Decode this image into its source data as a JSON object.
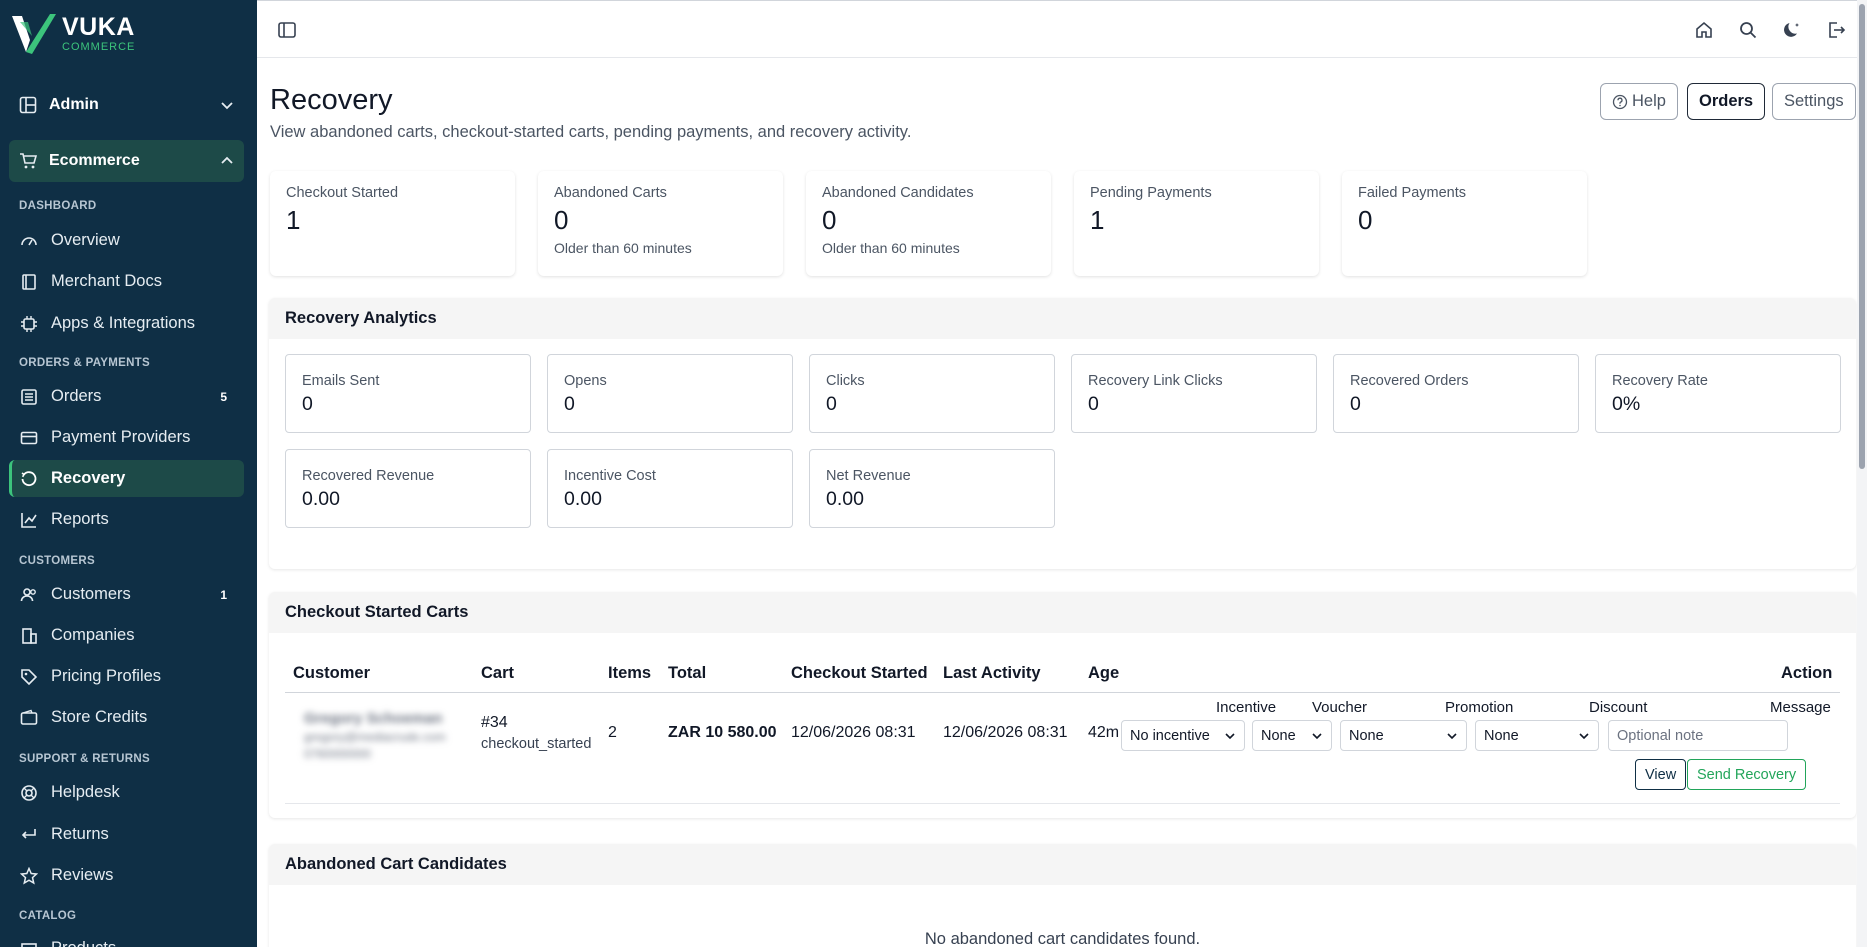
{
  "brand": {
    "name": "VUKA",
    "sub": "COMMERCE"
  },
  "sidebar": {
    "admin_group": "Admin",
    "ecommerce_group": "Ecommerce",
    "sections": {
      "dashboard": "DASHBOARD",
      "orders_payments": "ORDERS & PAYMENTS",
      "customers": "CUSTOMERS",
      "support_returns": "SUPPORT & RETURNS",
      "catalog": "CATALOG"
    },
    "items": {
      "overview": "Overview",
      "merchant_docs": "Merchant Docs",
      "apps": "Apps & Integrations",
      "orders": "Orders",
      "orders_badge": "5",
      "payment_providers": "Payment Providers",
      "recovery": "Recovery",
      "reports": "Reports",
      "customers": "Customers",
      "customers_badge": "1",
      "companies": "Companies",
      "pricing_profiles": "Pricing Profiles",
      "store_credits": "Store Credits",
      "helpdesk": "Helpdesk",
      "returns": "Returns",
      "reviews": "Reviews",
      "products": "Products"
    }
  },
  "header": {
    "title": "Recovery",
    "description": "View abandoned carts, checkout-started carts, pending payments, and recovery activity.",
    "help_label": "Help",
    "orders_label": "Orders",
    "settings_label": "Settings"
  },
  "stats": [
    {
      "label": "Checkout Started",
      "value": "1",
      "sub": ""
    },
    {
      "label": "Abandoned Carts",
      "value": "0",
      "sub": "Older than 60 minutes"
    },
    {
      "label": "Abandoned Candidates",
      "value": "0",
      "sub": "Older than 60 minutes"
    },
    {
      "label": "Pending Payments",
      "value": "1",
      "sub": ""
    },
    {
      "label": "Failed Payments",
      "value": "0",
      "sub": ""
    }
  ],
  "analytics": {
    "title": "Recovery Analytics",
    "metrics": [
      {
        "label": "Emails Sent",
        "value": "0"
      },
      {
        "label": "Opens",
        "value": "0"
      },
      {
        "label": "Clicks",
        "value": "0"
      },
      {
        "label": "Recovery Link Clicks",
        "value": "0"
      },
      {
        "label": "Recovered Orders",
        "value": "0"
      },
      {
        "label": "Recovery Rate",
        "value": "0%"
      },
      {
        "label": "Recovered Revenue",
        "value": "0.00"
      },
      {
        "label": "Incentive Cost",
        "value": "0.00"
      },
      {
        "label": "Net Revenue",
        "value": "0.00"
      }
    ]
  },
  "checkout_carts": {
    "title": "Checkout Started Carts",
    "columns": {
      "customer": "Customer",
      "cart": "Cart",
      "items": "Items",
      "total": "Total",
      "checkout_started": "Checkout Started",
      "last_activity": "Last Activity",
      "age": "Age",
      "action": "Action"
    },
    "row": {
      "customer_name": "Gregory Schoeman",
      "customer_email": "gregory@mediacrude.com",
      "customer_phone": "0760000000",
      "cart_id": "#34",
      "cart_status": "checkout_started",
      "items": "2",
      "total": "ZAR 10 580.00",
      "checkout_started": "12/06/2026 08:31",
      "last_activity": "12/06/2026 08:31",
      "age": "42m"
    },
    "controls": {
      "incentive_label": "Incentive",
      "incentive_value": "No incentive",
      "voucher_label": "Voucher",
      "voucher_value": "None",
      "promotion_label": "Promotion",
      "promotion_value": "None",
      "discount_label": "Discount",
      "discount_value": "None",
      "message_label": "Message",
      "message_placeholder": "Optional note",
      "view_label": "View",
      "send_label": "Send Recovery"
    }
  },
  "candidates": {
    "title": "Abandoned Cart Candidates",
    "empty": "No abandoned cart candidates found."
  },
  "colors": {
    "sidebar": "#0f2f45",
    "active": "#1d4a48",
    "accent": "#3cc47c",
    "send": "#22a55a"
  }
}
